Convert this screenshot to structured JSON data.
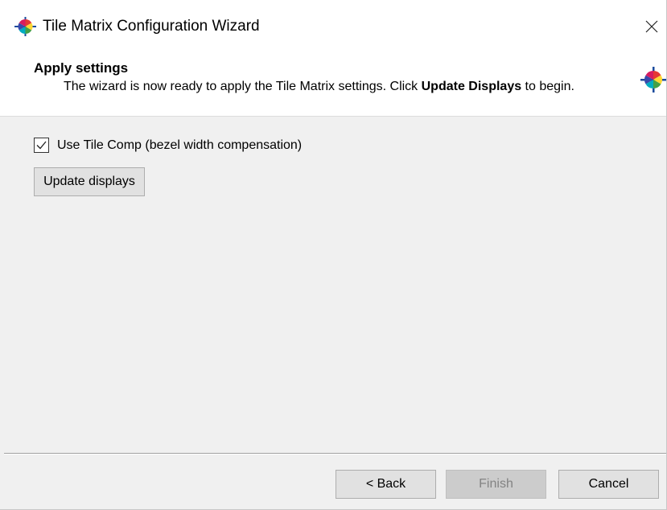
{
  "window": {
    "title": "Tile Matrix Configuration Wizard",
    "icon": "color-wheel-icon",
    "close_icon": "close-icon"
  },
  "header": {
    "title": "Apply settings",
    "desc_before": "The wizard is now ready to apply the Tile Matrix settings. Click ",
    "desc_bold": "Update Displays",
    "desc_after": " to begin.",
    "icon": "color-wheel-icon"
  },
  "content": {
    "checkbox": {
      "label": "Use Tile Comp (bezel width compensation)",
      "checked": true
    },
    "update_button": "Update displays"
  },
  "footer": {
    "back_label": "< Back",
    "finish_label": "Finish",
    "finish_enabled": false,
    "cancel_label": "Cancel"
  },
  "colors": {
    "dialog_bg": "#f0f0f0",
    "header_bg": "#ffffff",
    "button_bg": "#e1e1e1",
    "disabled_text": "#838383"
  }
}
